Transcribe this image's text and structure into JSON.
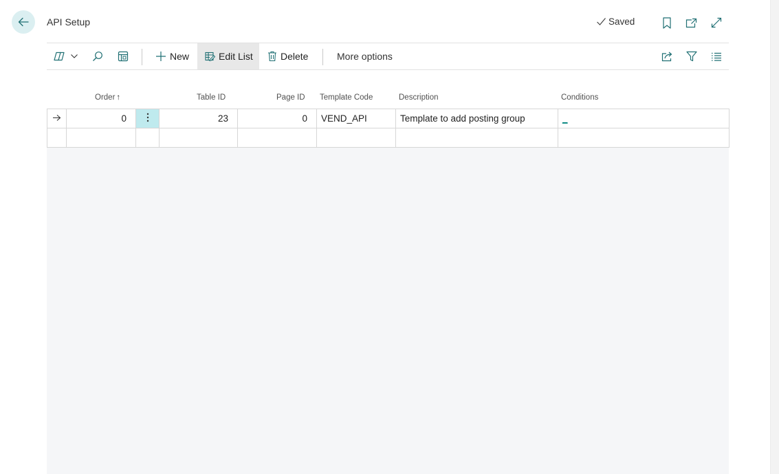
{
  "header": {
    "title": "API Setup",
    "saved_label": "Saved"
  },
  "actionbar": {
    "new_label": "New",
    "edit_list_label": "Edit List",
    "delete_label": "Delete",
    "more_options_label": "More options"
  },
  "table": {
    "columns": {
      "order": "Order",
      "order_sort_indicator": "↑",
      "table_id": "Table ID",
      "page_id": "Page ID",
      "template_code": "Template Code",
      "description": "Description",
      "conditions": "Conditions"
    },
    "rows": [
      {
        "order": "0",
        "table_id": "23",
        "page_id": "0",
        "template_code": "VEND_API",
        "description": "Template to add posting group",
        "conditions": "_"
      }
    ]
  },
  "colors": {
    "accent": "#00847e",
    "back_button_bg": "#dbeff1",
    "selected_cell_bg": "#bfeaee",
    "grid_bg": "#f5f6f8"
  }
}
